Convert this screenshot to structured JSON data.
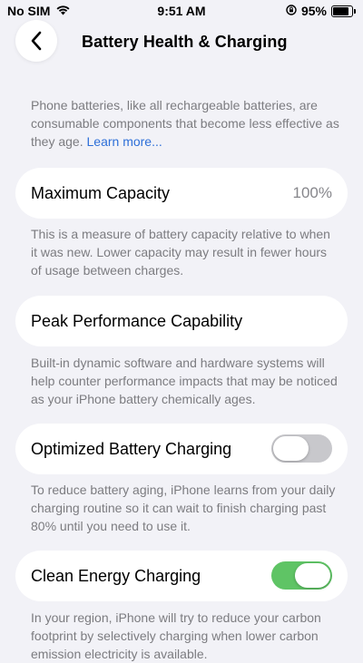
{
  "status_bar": {
    "carrier": "No SIM",
    "time": "9:51 AM",
    "battery_percent": "95%",
    "battery_level": 0.95,
    "icons": [
      "wifi-icon",
      "orientation-lock-icon",
      "battery-icon"
    ]
  },
  "nav": {
    "back_icon": "chevron-left-icon",
    "title": "Battery Health & Charging"
  },
  "intro": {
    "text": "Phone batteries, like all rechargeable batteries, are consumable components that become less effective as they age.",
    "link": "Learn more..."
  },
  "sections": {
    "max_capacity": {
      "label": "Maximum Capacity",
      "value": "100%",
      "footnote": "This is a measure of battery capacity relative to when it was new. Lower capacity may result in fewer hours of usage between charges."
    },
    "peak_performance": {
      "label": "Peak Performance Capability",
      "footnote": "Built-in dynamic software and hardware systems will help counter performance impacts that may be noticed as your iPhone battery chemically ages."
    },
    "optimized_charging": {
      "label": "Optimized Battery Charging",
      "enabled": false,
      "footnote": "To reduce battery aging, iPhone learns from your daily charging routine so it can wait to finish charging past 80% until you need to use it."
    },
    "clean_energy": {
      "label": "Clean Energy Charging",
      "enabled": true,
      "footnote": "In your region, iPhone will try to reduce your carbon footprint by selectively charging when lower carbon emission electricity is available."
    }
  },
  "colors": {
    "background": "#f2f2f7",
    "toggle_on": "#5fc465",
    "toggle_off": "#c8c8cc",
    "link": "#2d6fd8",
    "secondary_text": "#7c7c80"
  }
}
